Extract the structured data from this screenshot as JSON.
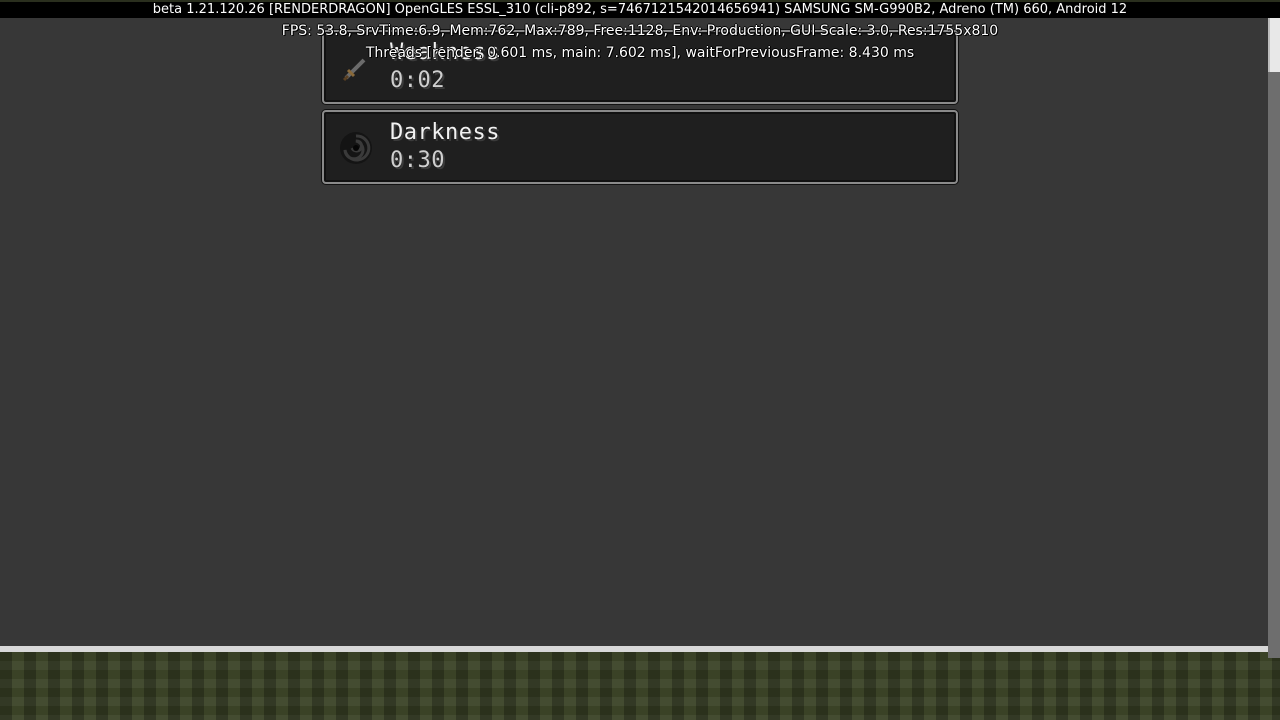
{
  "debug": {
    "line1": "beta 1.21.120.26 [RENDERDRAGON] OpenGLES ESSL_310 (cli-p892, s=7467121542014656941) SAMSUNG SM-G990B2, Adreno (TM) 660, Android 12",
    "line2": "FPS: 53.8, SrvTime:6.9, Mem:762, Max:789, Free:1128, Env: Production, GUI Scale: 3.0, Res:1755x810",
    "line3": "Threads [render: 0.601 ms, main: 7.602 ms], waitForPreviousFrame: 8.430 ms"
  },
  "effects": [
    {
      "name": "Weakness",
      "time": "0:02",
      "icon": "sword-icon"
    },
    {
      "name": "Darkness",
      "time": "0:30",
      "icon": "darkness-swirl-icon"
    }
  ]
}
